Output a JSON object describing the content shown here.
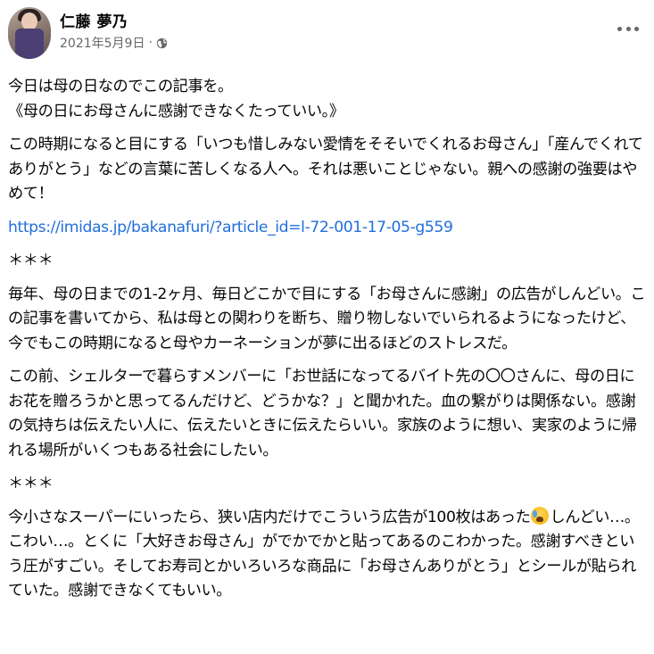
{
  "post": {
    "author": "仁藤 夢乃",
    "date": "2021年5月9日",
    "separator": "·",
    "privacy_icon": "globe-icon",
    "menu_icon": "more-options-icon",
    "paragraphs": [
      {
        "lines": [
          "今日は母の日なのでこの記事を。",
          "《母の日にお母さんに感謝できなくたっていい。》"
        ]
      },
      {
        "text": "この時期になると目にする「いつも惜しみない愛情をそそいでくれるお母さん」「産んでくれてありがとう」などの言葉に苦しくなる人へ。それは悪いことじゃない。親への感謝の強要はやめて！"
      },
      {
        "link": "https://imidas.jp/bakanafuri/?article_id=l-72-001-17-05-g559"
      },
      {
        "text": "＊＊＊"
      },
      {
        "text": "毎年、母の日までの1-2ヶ月、毎日どこかで目にする「お母さんに感謝」の広告がしんどい。この記事を書いてから、私は母との関わりを断ち、贈り物しないでいられるようになったけど、今でもこの時期になると母やカーネーションが夢に出るほどのストレスだ。"
      },
      {
        "text": "この前、シェルターで暮らすメンバーに「お世話になってるバイト先の〇〇さんに、母の日にお花を贈ろうかと思ってるんだけど、どうかな？」と聞かれた。血の繋がりは関係ない。感謝の気持ちは伝えたい人に、伝えたいときに伝えたらいい。家族のように想い、実家のように帰れる場所がいくつもある社会にしたい。"
      },
      {
        "text": "＊＊＊"
      },
      {
        "before_emoji": "今小さなスーパーにいったら、狭い店内だけでこういう広告が100枚はあった",
        "emoji": "crying-face-emoji",
        "after_emoji": "しんどい…。こわい…。とくに「大好きお母さん」がでかでかと貼ってあるのこわかった。感謝すべきという圧がすごい。そしてお寿司とかいろいろな商品に「お母さんありがとう」とシールが貼られていた。感謝できなくてもいい。"
      }
    ]
  },
  "colors": {
    "text": "#050505",
    "secondary": "#65676b",
    "link": "#216fdb",
    "background": "#ffffff"
  }
}
